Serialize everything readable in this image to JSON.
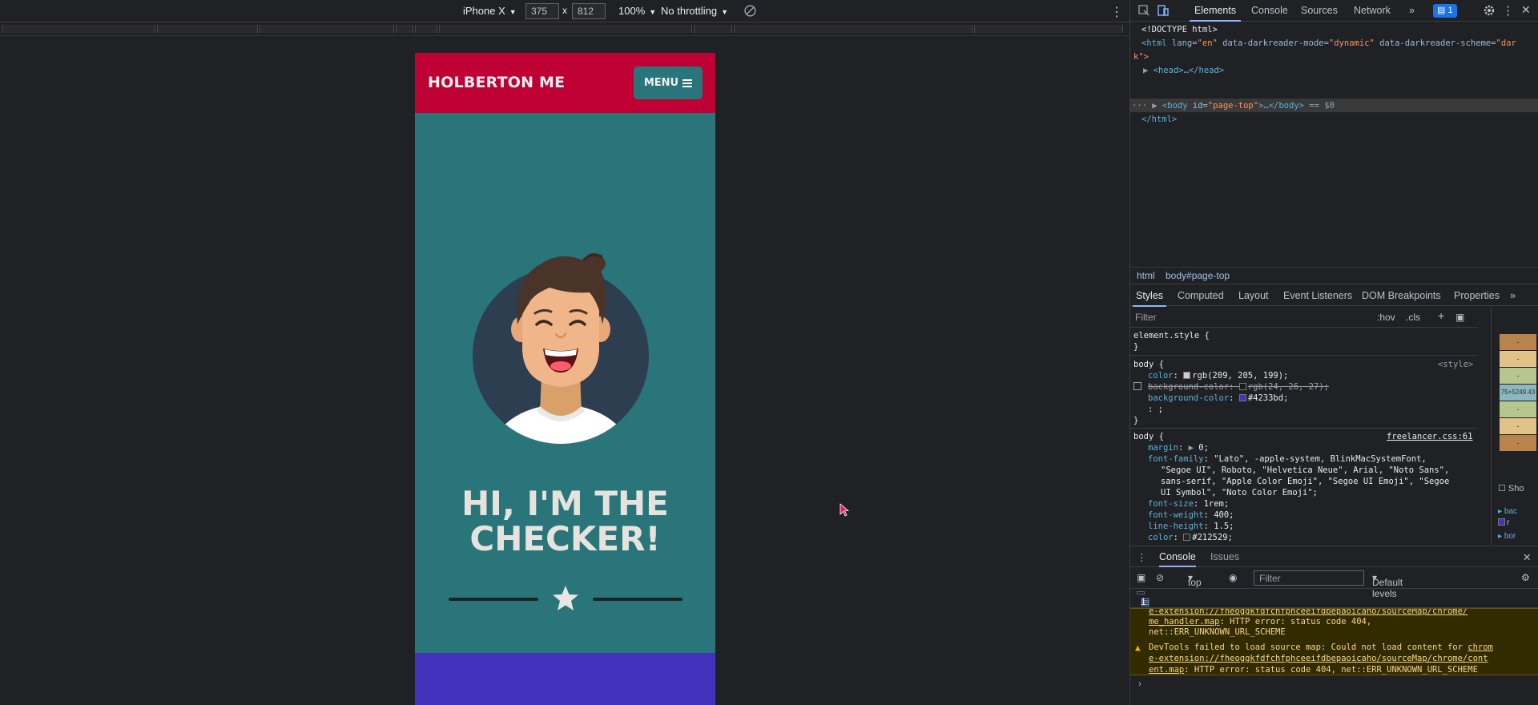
{
  "device_toolbar": {
    "device": "iPhone X",
    "width": "375",
    "times": "x",
    "height": "812",
    "zoom": "100%",
    "throttling": "No throttling",
    "more": "⋮"
  },
  "site": {
    "brand": "HOLBERTON ME",
    "menu_label": "MENU",
    "headline_line1": "HI, I'M THE",
    "headline_line2": "CHECKER!"
  },
  "devtools": {
    "tabs": [
      "Elements",
      "Console",
      "Sources",
      "Network",
      "»"
    ],
    "issue_count": "1",
    "dom": {
      "doctype": "<!DOCTYPE html>",
      "html_open_tag": "<html",
      "html_attr1": " lang=",
      "html_attr1_val": "\"en\"",
      "html_attr2": " data-darkreader-mode=",
      "html_attr2_val": "\"dynamic\"",
      "html_attr3": " data-darkreader-scheme=",
      "html_attr3_val": "\"dar",
      "html_line2": "k\">",
      "head": "<head>…</head>",
      "body_tag": "<body",
      "body_attr": " id=",
      "body_attr_val": "\"page-top\"",
      "body_close": ">…</body>",
      "body_suffix": " == $0",
      "html_close": "</html>"
    },
    "breadcrumbs": [
      "html",
      "body#page-top"
    ],
    "sub_tabs": [
      "Styles",
      "Computed",
      "Layout",
      "Event Listeners",
      "DOM Breakpoints",
      "Properties",
      "»"
    ],
    "styles_filter_placeholder": "Filter",
    "hov": ":hov",
    "cls": ".cls",
    "rules": {
      "element_style": "element.style {",
      "close": "}",
      "body_sel": "body {",
      "style_src": "<style>",
      "color_prop": "color",
      "color_val": "rgb(209, 205, 199);",
      "bg_prop": "background-color",
      "bg_old_val": "rgb(24, 26, 27);",
      "bg_new_val": "#4233bd;",
      "semi": ": ;",
      "freelancer_src": "freelancer.css:61",
      "margin_prop": "margin",
      "margin_val": "0;",
      "ff_prop": "font-family",
      "ff_val1": "\"Lato\", -apple-system, BlinkMacSystemFont,",
      "ff_val2": "\"Segoe UI\", Roboto, \"Helvetica Neue\", Arial, \"Noto Sans\",",
      "ff_val3": "sans-serif, \"Apple Color Emoji\", \"Segoe UI Emoji\", \"Segoe",
      "ff_val4": "UI Symbol\", \"Noto Color Emoji\";",
      "fs_prop": "font-size",
      "fs_val": "1rem;",
      "fw_prop": "font-weight",
      "fw_val": "400;",
      "lh_prop": "line-height",
      "lh_val": "1.5;",
      "color2_prop": "color",
      "color2_val": "#212529;"
    },
    "boxmodel_label": "75×5249.43",
    "show_label": "Sho",
    "side_props": [
      "bac",
      "r",
      "bor"
    ],
    "console_tabs": [
      "Console",
      "Issues"
    ],
    "context": "top",
    "console_filter_placeholder": "Filter",
    "levels": "Default levels",
    "issue_row_label": "1 Issue:",
    "issue_row_count": "1",
    "warnings": {
      "w1_line1": "e-extension://fheoggkfdfchfphceeifdbepaoicaho/sourceMap/chrome/",
      "w1_line2": "me_handler.map",
      "w1_line2_rest": ": HTTP error: status code 404,",
      "w1_line3": "net::ERR_UNKNOWN_URL_SCHEME",
      "w2_line1": "DevTools failed to load source map: Could not load content for ",
      "w2_link1": "chrom",
      "w2_line2": "e-extension://fheoggkfdfchfphceeifdbepaoicaho/sourceMap/chrome/cont",
      "w2_line3_link": "ent.map",
      "w2_line3_rest": ": HTTP error: status code 404, net::ERR_UNKNOWN_URL_SCHEME"
    },
    "prompt": "›"
  },
  "colors": {
    "navbar": "#bf0034",
    "masthead": "#2a7579",
    "footer_band": "#4233bd",
    "accent": "#8ab4f8"
  }
}
